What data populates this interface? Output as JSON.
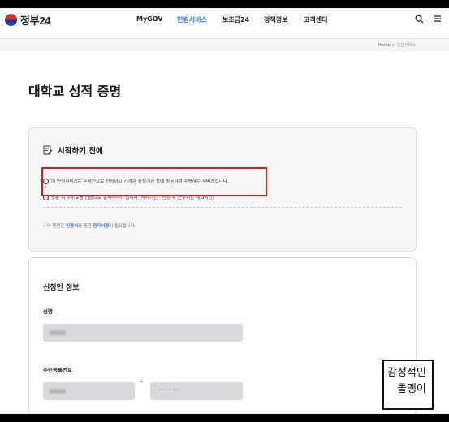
{
  "header": {
    "logo_text": "정부24",
    "nav": [
      {
        "label": "MyGOV",
        "active": false
      },
      {
        "label": "민원서비스",
        "active": true
      },
      {
        "label": "보조금24",
        "active": false
      },
      {
        "label": "정책정보",
        "active": false
      },
      {
        "label": "고객센터",
        "active": false
      }
    ]
  },
  "breadcrumb": {
    "home": "Home",
    "separator": ">",
    "current": "민원서비스"
  },
  "page_title": "대학교 성적 증명",
  "before_start": {
    "title": "시작하기 전에",
    "notices": [
      "이 민원서비스는 온라인으로 신청하고 가까운 행정기관 등에 방문하여 수령하는 서비스입니다.",
      "방문 시 수수료를 현금으로 결제하셔야 합니다.(처리기간 : 신청 후 근무시간 내 3시간)"
    ],
    "note_prefix": "• 이 민원은 ",
    "note_hl1": "인증서",
    "note_mid": "를 통한 ",
    "note_hl2": "전자서명",
    "note_suffix": "이 필요합니다."
  },
  "applicant": {
    "title": "신청인 정보",
    "name_label": "성명",
    "rrn_label": "주민등록번호",
    "rrn_separator": "–",
    "rrn_back_masked": "·······"
  },
  "signature": {
    "line1": "감성적인",
    "line2": "돌멩이"
  },
  "colors": {
    "accent": "#256ef4",
    "highlight_box": "#e8141b"
  }
}
